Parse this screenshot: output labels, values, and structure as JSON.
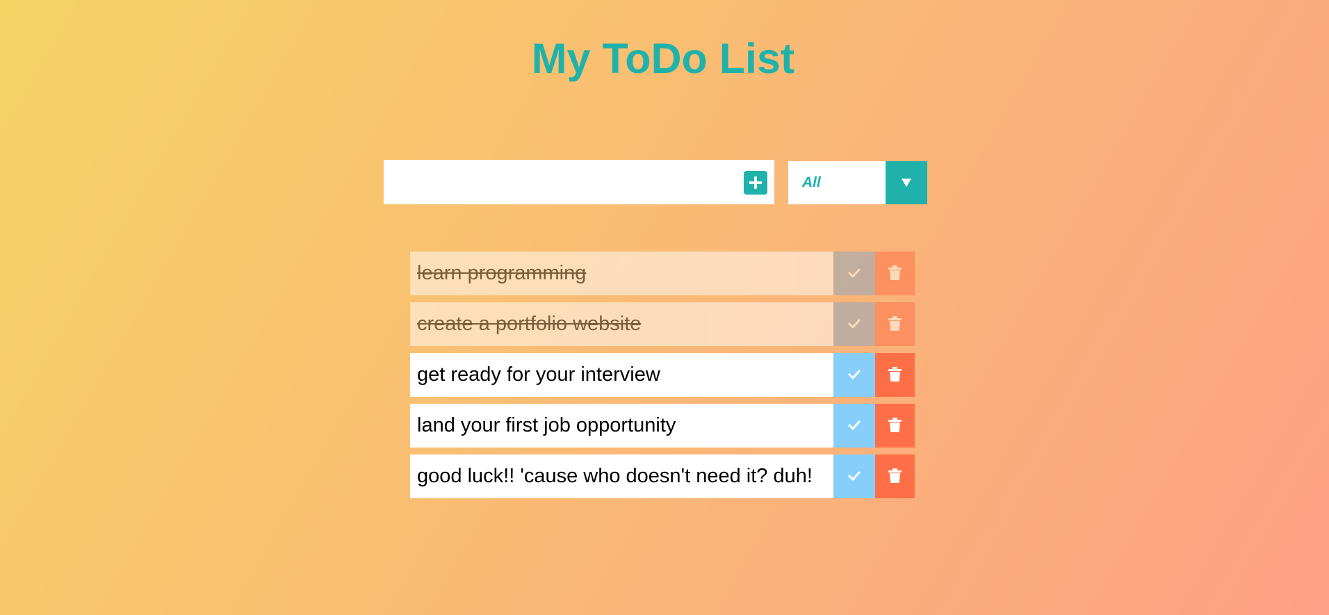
{
  "header": {
    "title": "My ToDo List"
  },
  "new_todo": {
    "value": "",
    "placeholder": "",
    "add_icon": "plus-square-icon"
  },
  "filter": {
    "selected": "All",
    "arrow_icon": "caret-down-icon"
  },
  "todos": [
    {
      "text": "learn programming",
      "completed": true
    },
    {
      "text": "create a portfolio website",
      "completed": true
    },
    {
      "text": "get ready for your interview",
      "completed": false
    },
    {
      "text": "land your first job opportunity",
      "completed": false
    },
    {
      "text": "good luck!! 'cause who doesn't need it? duh!",
      "completed": false
    }
  ],
  "icons": {
    "complete": "check-icon",
    "delete": "trash-icon"
  },
  "colors": {
    "accent": "#20b2aa",
    "complete_button": "#87cefa",
    "delete_button": "#ff6f47",
    "gradient_start": "#f6d365",
    "gradient_end": "#fda085"
  }
}
